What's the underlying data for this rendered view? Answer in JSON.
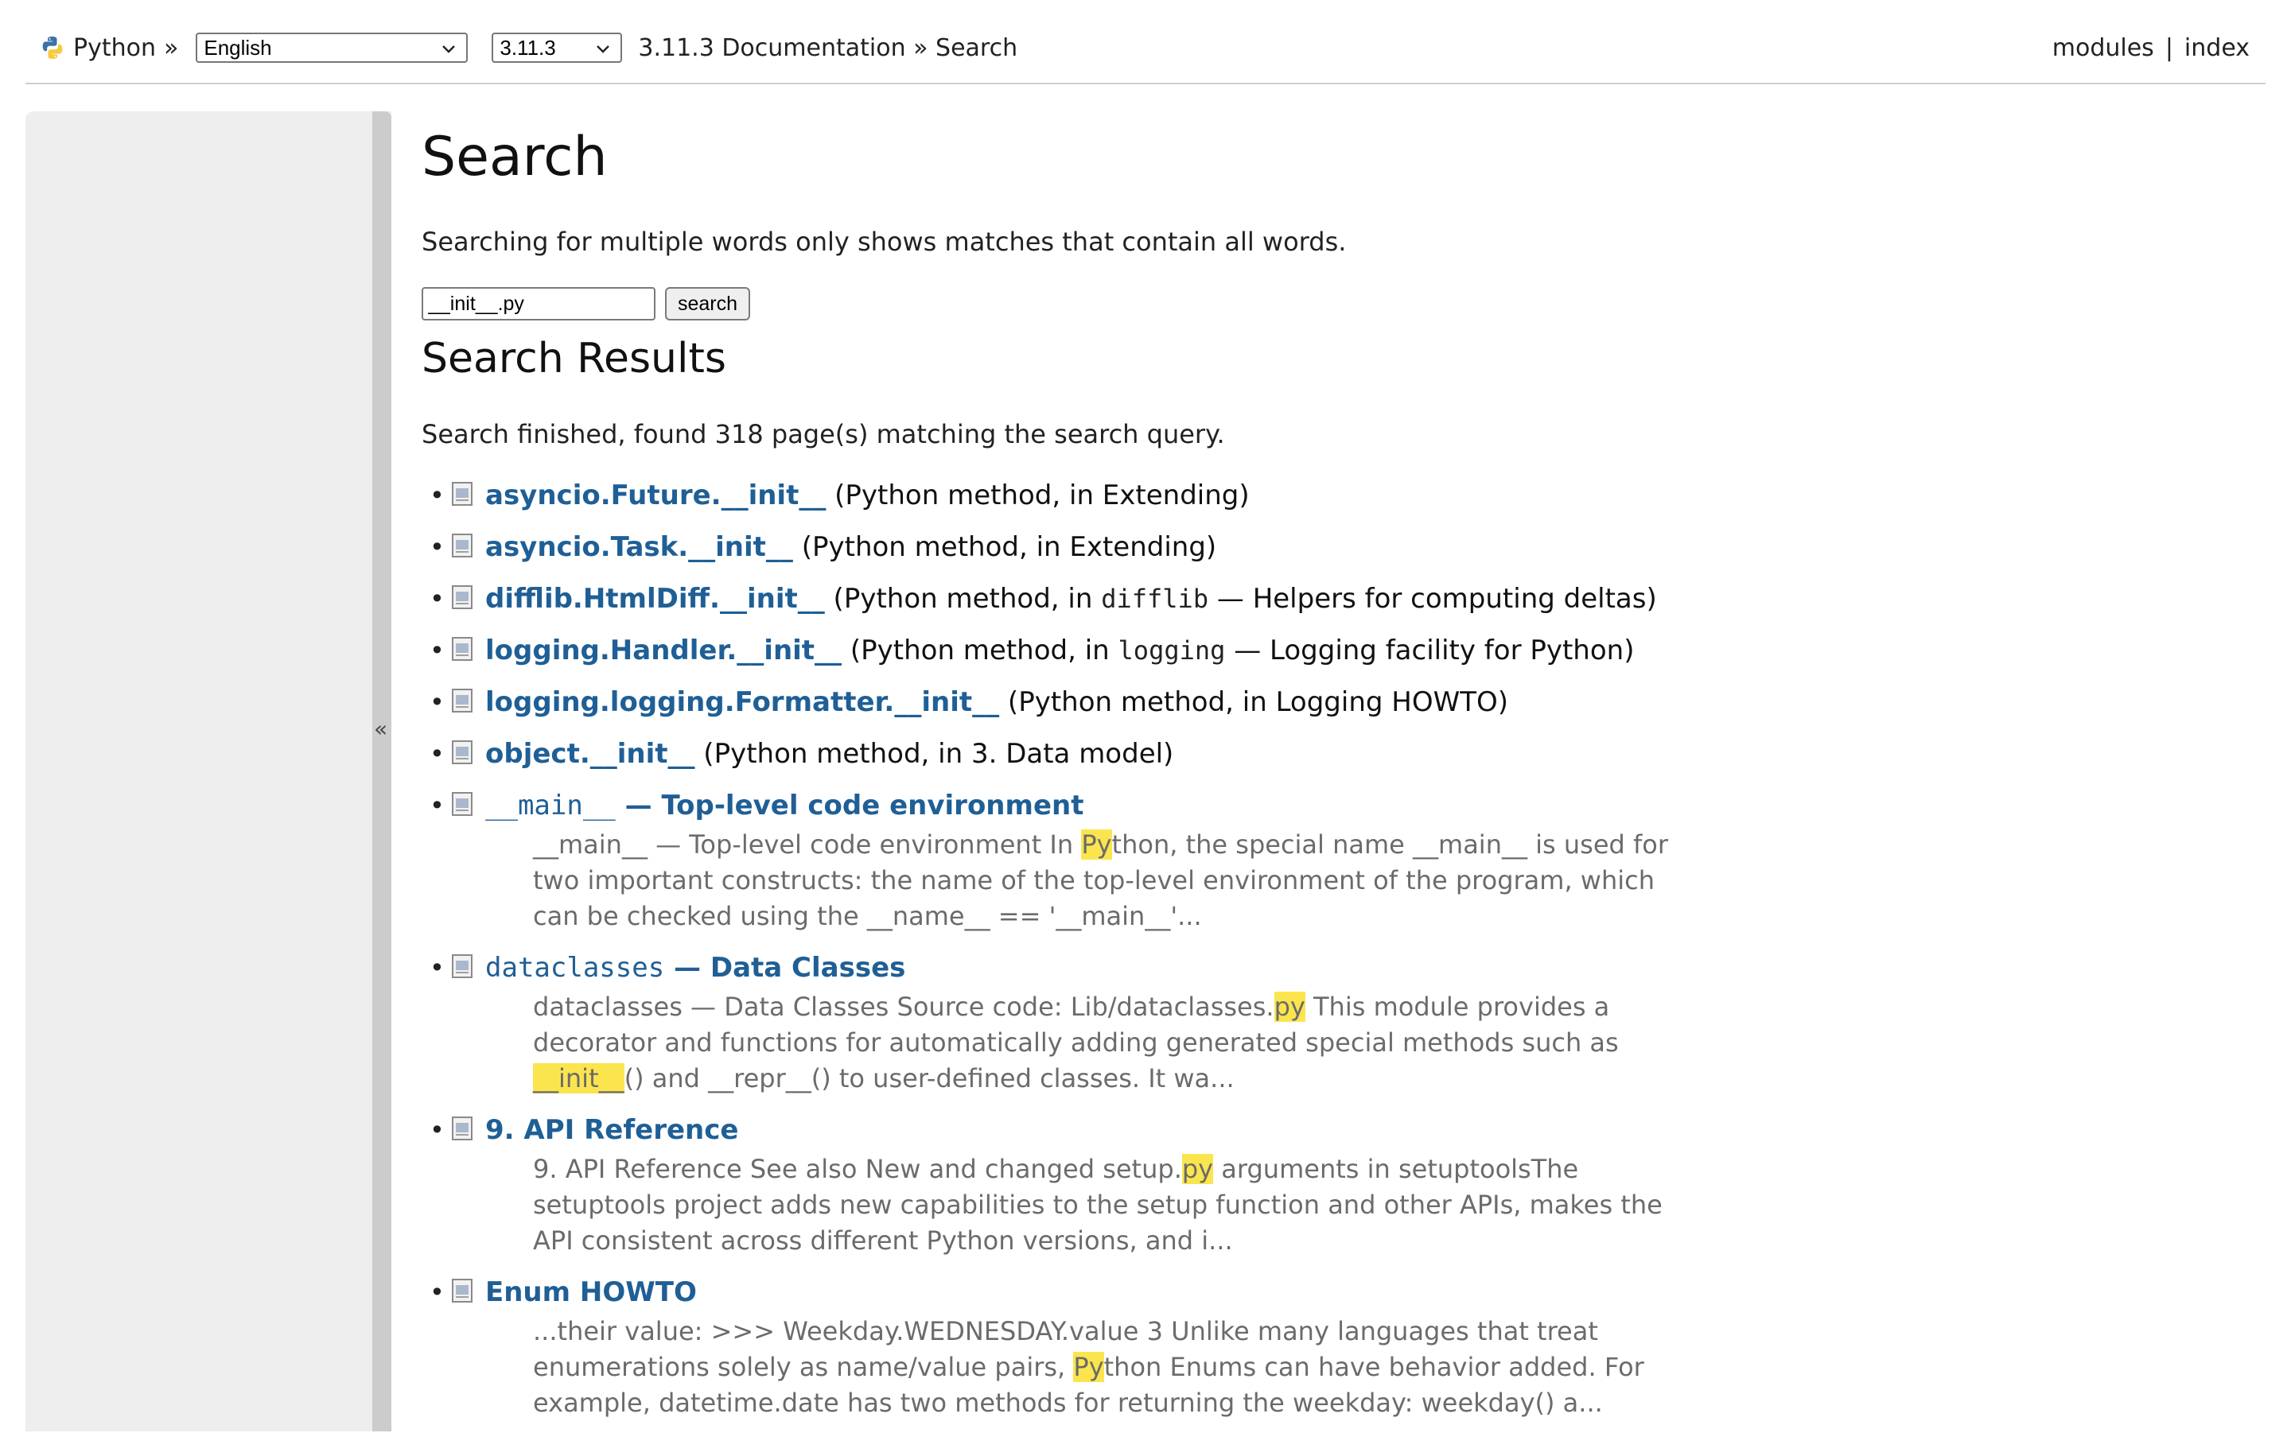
{
  "header": {
    "site_name": "Python",
    "separator": "»",
    "language": "English",
    "version": "3.11.3",
    "breadcrumb_doc": "3.11.3 Documentation",
    "breadcrumb_sep": "»",
    "breadcrumb_page": "Search",
    "nav_modules": "modules",
    "nav_pipe": "|",
    "nav_index": "index"
  },
  "sidebar": {
    "collapse_glyph": "«"
  },
  "page": {
    "title": "Search",
    "note": "Searching for multiple words only shows matches that contain all words.",
    "search_value": "__init__.py",
    "search_button": "search",
    "results_title": "Search Results",
    "status": "Search finished, found 318 page(s) matching the search query."
  },
  "results": [
    {
      "link": "asyncio.Future.__init__",
      "desc": " (Python method, in Extending)"
    },
    {
      "link": "asyncio.Task.__init__",
      "desc": " (Python method, in Extending)"
    },
    {
      "link": "difflib.HtmlDiff.__init__",
      "desc_a": " (Python method, in ",
      "code": "difflib",
      "desc_b": " — Helpers for computing deltas)"
    },
    {
      "link": "logging.Handler.__init__",
      "desc_a": " (Python method, in ",
      "code": "logging",
      "desc_b": " — Logging facility for Python)"
    },
    {
      "link": "logging.logging.Formatter.__init__",
      "desc": " (Python method, in Logging HOWTO)"
    },
    {
      "link": "object.__init__",
      "desc": " (Python method, in 3. Data model)"
    },
    {
      "link_mono": "__main__",
      "link_rest": " — Top-level code environment",
      "s1": "__main__ — Top-level code environment In ",
      "h1": "Py",
      "s2": "thon, the special name __main__ is used for two important constructs: the name of the top-level environment of the program, which can be checked using the __name__ == '__main__'..."
    },
    {
      "link_mono": "dataclasses",
      "link_rest": " — Data Classes",
      "s1": "dataclasses — Data Classes Source code: Lib/dataclasses.",
      "h1": "py",
      "s2": " This module provides a decorator and functions for automatically adding generated special methods such as ",
      "h2": "__init__",
      "s3": "() and __repr__() to user-defined classes. It wa..."
    },
    {
      "link": "9. API Reference",
      "s1": "9. API Reference See also New and changed setup.",
      "h1": "py",
      "s2": " arguments in setuptoolsThe setuptools project adds new capabilities to the setup function and other APIs, makes the API consistent across different Python versions, and i..."
    },
    {
      "link": "Enum HOWTO",
      "s1": "...their value: >>> Weekday.WEDNESDAY.value 3 Unlike many languages that treat enumerations solely as name/value pairs, ",
      "h1": "Py",
      "s2": "thon Enums can have behavior added. For example, datetime.date has two methods for returning the weekday: weekday() a..."
    }
  ]
}
